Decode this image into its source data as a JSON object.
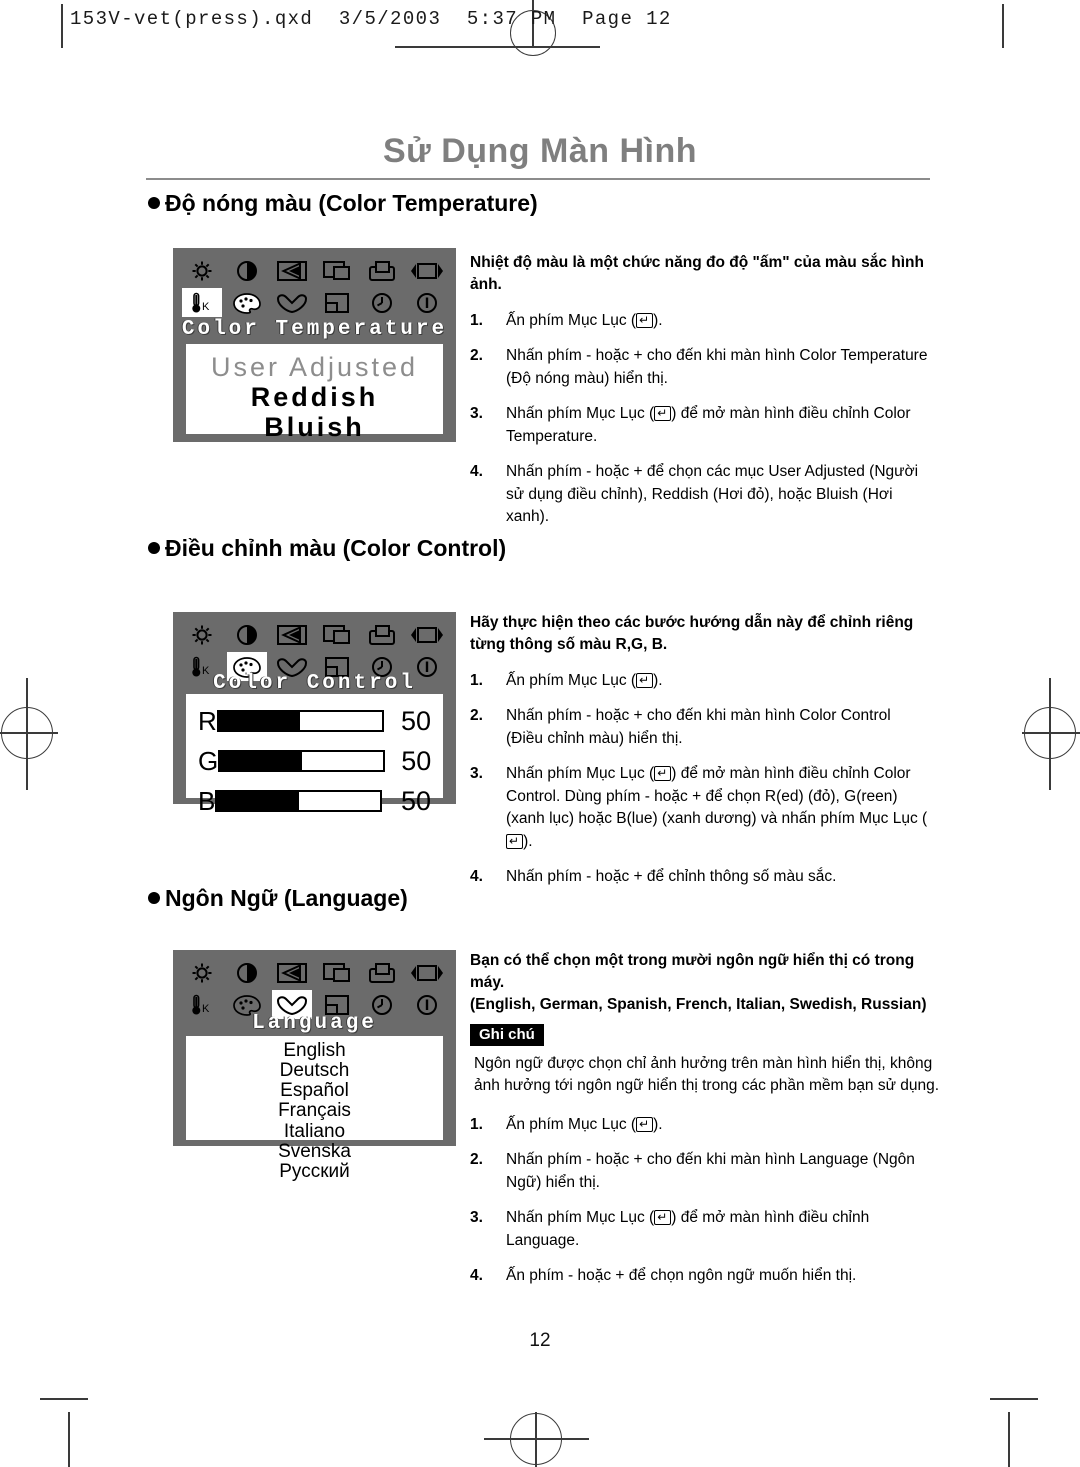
{
  "prepress": {
    "file_header": "153V-vet(press).qxd  3/5/2003  5:37 PM  Page 12"
  },
  "page": {
    "title": "Sử Dụng Màn Hình",
    "number": "12"
  },
  "sections": [
    {
      "heading": "Độ nóng màu (Color Temperature)",
      "osd": {
        "menu_label": "Color Temperature",
        "selected_icon": "color-temperature-icon",
        "options": [
          {
            "label": "User Adjusted",
            "state": "dim"
          },
          {
            "label": "Reddish",
            "state": "on"
          },
          {
            "label": "Bluish",
            "state": "on"
          }
        ]
      },
      "intro": "Nhiệt độ màu là một chức năng đo độ \"ấm\" của màu sắc hình ảnh.",
      "steps": [
        {
          "num": "1.",
          "text": "Ấn phím Mục Lục (",
          "text2": ")."
        },
        {
          "num": "2.",
          "text": "Nhấn phím - hoặc + cho đến khi màn hình Color Temperature (Độ nóng màu) hiển thị."
        },
        {
          "num": "3.",
          "text": "Nhấn phím Mục Lục (",
          "text2": ") để mở màn hình điều chỉnh Color Temperature."
        },
        {
          "num": "4.",
          "text": "Nhấn phím - hoặc + để chọn các mục User Adjusted (Người sử dụng điều chỉnh), Reddish (Hơi đỏ), hoặc Bluish (Hơi xanh)."
        }
      ]
    },
    {
      "heading": "Điều chỉnh màu (Color Control)",
      "osd": {
        "menu_label": "Color Control",
        "selected_icon": "color-control-icon",
        "sliders": [
          {
            "letter": "R",
            "value": "50",
            "percent": 50
          },
          {
            "letter": "G",
            "value": "50",
            "percent": 50
          },
          {
            "letter": "B",
            "value": "50",
            "percent": 50
          }
        ]
      },
      "intro": "Hãy thực hiện theo các bước hướng dẫn này để chỉnh riêng từng thông số màu R,G, B.",
      "steps": [
        {
          "num": "1.",
          "text": "Ấn phím Mục Lục (",
          "text2": ")."
        },
        {
          "num": "2.",
          "text": "Nhấn phím - hoặc + cho đến khi màn hình Color Control (Điều chỉnh màu) hiển thị."
        },
        {
          "num": "3.",
          "text": "Nhấn phím Mục Lục (",
          "text2": ") để mở màn hình điều chỉnh Color Control. Dùng phím - hoặc + để chọn R(ed) (đỏ), G(reen) (xanh lục) hoặc B(lue) (xanh dương) và nhấn phím Mục Lục (",
          "text3": ")."
        },
        {
          "num": "4.",
          "text": "Nhấn phím - hoặc + để chỉnh thông số màu sắc."
        }
      ]
    },
    {
      "heading": "Ngôn Ngữ (Language)",
      "osd": {
        "menu_label": "Language",
        "selected_icon": "language-icon",
        "languages": [
          "English",
          "Deutsch",
          "Español",
          "Français",
          "Italiano",
          "Svenska",
          "Русский"
        ]
      },
      "intro": "Bạn có thể chọn một trong mười ngôn ngữ hiển thị có trong máy.",
      "intro2": "(English, German, Spanish, French, Italian, Swedish, Russian)",
      "note_badge": "Ghi chú",
      "note_body": "Ngôn ngữ được chọn chỉ ảnh hưởng trên màn hình hiển thị, không ảnh hưởng tới ngôn ngữ hiển thị trong các phần mềm bạn sử dụng.",
      "steps": [
        {
          "num": "1.",
          "text": "Ấn phím Mục Lục (",
          "text2": ")."
        },
        {
          "num": "2.",
          "text": "Nhấn phím - hoặc + cho đến khi màn hình Language (Ngôn Ngữ) hiển thị."
        },
        {
          "num": "3.",
          "text": "Nhấn phím Mục Lục (",
          "text2": ") để mở màn hình điều chỉnh Language."
        },
        {
          "num": "4.",
          "text": "Ấn phím - hoặc + để chọn ngôn ngữ muốn hiển thị."
        }
      ]
    }
  ],
  "osd_icons": {
    "row1": [
      "brightness-icon",
      "contrast-icon",
      "image-lock-icon",
      "h-position-icon",
      "v-position-icon",
      "h-size-icon"
    ],
    "row2": [
      "color-temperature-icon",
      "color-control-icon",
      "language-icon",
      "osd-position-icon",
      "osd-time-icon",
      "information-icon"
    ]
  },
  "colors": {
    "osd_background": "#6b6b6b",
    "osd_screen": "#ffffff",
    "title_gray": "#7f7f7f"
  },
  "key_glyph": "↵"
}
